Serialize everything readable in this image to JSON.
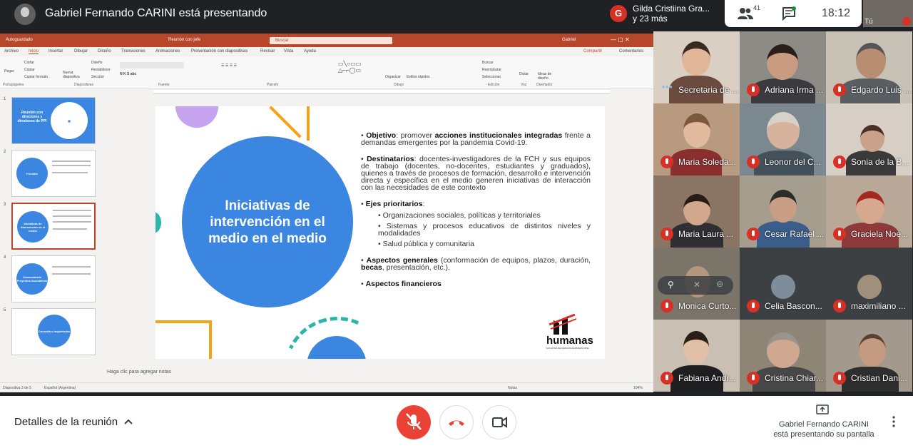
{
  "header": {
    "presenter_title": "Gabriel Fernando CARINI está presentando",
    "speaker_card": {
      "initial": "G",
      "name": "Gilda Cristiina Gra...",
      "more": "y 23 más"
    },
    "participants_count": "41",
    "time": "18:12",
    "self_label": "Tú"
  },
  "powerpoint": {
    "autosave": "Autoguardado",
    "doc_title": "Reunión con jefe",
    "search_placeholder": "Buscar",
    "user": "Gabriel",
    "menu": [
      "Archivo",
      "Inicio",
      "Insertar",
      "Dibujar",
      "Diseño",
      "Transiciones",
      "Animaciones",
      "Presentación con diapositivas",
      "Revisar",
      "Vista",
      "Ayuda"
    ],
    "share": "Compartir",
    "comments": "Comentarios",
    "ribbon_groups": [
      "Portapapeles",
      "Diapositivas",
      "Fuente",
      "Párrafo",
      "Dibujo",
      "Edición",
      "Voz",
      "Diseñador"
    ],
    "ribbon_buttons": {
      "paste": "Pegar",
      "cut": "Cortar",
      "copy": "Copiar",
      "format_painter": "Copiar formato",
      "new_slide": "Nueva diapositiva",
      "layout": "Diseño",
      "reset": "Restablecer",
      "section": "Sección",
      "arrange": "Organizar",
      "quick_styles": "Estilos rápidos",
      "find": "Buscar",
      "replace": "Reemplazar",
      "select": "Seleccionar",
      "dictate": "Dictar",
      "designer_ideas": "Ideas de diseño"
    },
    "thumbnails": [
      {
        "num": "1",
        "text": "Reunión con directores y directores de PPI"
      },
      {
        "num": "2",
        "text": "Formato"
      },
      {
        "num": "3",
        "text": "Iniciativas de intervención en el medio"
      },
      {
        "num": "4",
        "text": "Convocatoria Proyectos Asociativos"
      },
      {
        "num": "5",
        "text": "Consulta o inquietudes"
      }
    ],
    "notes_placeholder": "Haga clic para agregar notas",
    "status": {
      "slide_info": "Diapositiva 3 de 5",
      "language": "Español (Argentina)",
      "notes": "Notas",
      "zoom": "104%"
    }
  },
  "slide": {
    "circle_title": "Iniciativas de intervención en el medio en el medio",
    "objective_label": "Objetivo",
    "objective_text": ": promover ",
    "objective_bold": "acciones institucionales integradas",
    "objective_rest": " frente a demandas emergentes por la pandemia Covid-19.",
    "recipients_label": "Destinatarios",
    "recipients_text": ": docentes-investigadores de la FCH y sus equipos de trabajo (docentes, no-docentes, estudiantes y graduados), quienes a través de procesos de formación, desarrollo e intervención directa y específica en el medio generen iniciativas de interacción con las necesidades de este contexto",
    "axes_label": "Ejes prioritarios",
    "axes": [
      "Organizaciones sociales, políticas y territoriales",
      "Sistemas y procesos educativos de distintos niveles y modalidades",
      "Salud pública y comunitaria"
    ],
    "general_label": "Aspectos generales",
    "general_text_1": " (conformación de equipos, plazos, duración, ",
    "general_bold": "becas",
    "general_text_2": ", presentación, etc.).",
    "financial_label": "Aspectos financieros",
    "logo_text": "humanas",
    "logo_sub": "FACULTAD DE CIENCIAS HUMANAS UNSL"
  },
  "participants": [
    {
      "name": "Secretaria de ...",
      "speaking": true
    },
    {
      "name": "Adriana Irma ..."
    },
    {
      "name": "Edgardo Luis ..."
    },
    {
      "name": "Maria Soleda..."
    },
    {
      "name": "Leonor del C..."
    },
    {
      "name": "Sonia de la B..."
    },
    {
      "name": "Maria Laura ..."
    },
    {
      "name": "Cesar Rafael ..."
    },
    {
      "name": "Graciela Noe..."
    },
    {
      "name": "Monica Curto..."
    },
    {
      "name": "Celia Bascon..."
    },
    {
      "name": "maximiliano ..."
    },
    {
      "name": "Fabiana Andr..."
    },
    {
      "name": "Cristina Chiar..."
    },
    {
      "name": "Cristian Dani..."
    }
  ],
  "footer": {
    "details": "Detalles de la reunión",
    "present_line1": "Gabriel Fernando CARINI",
    "present_line2": "está presentando su pantalla"
  },
  "colors": {
    "accent_red": "#ea4335",
    "ppt_brand": "#b7472a",
    "slide_blue": "#3b86e0"
  }
}
